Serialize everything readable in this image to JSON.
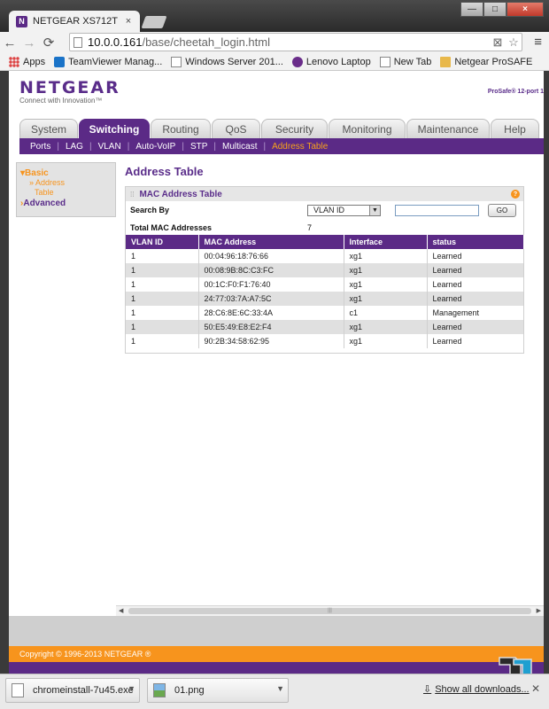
{
  "browser": {
    "tab_title": "NETGEAR XS712T",
    "tab_close": "×",
    "url_host": "10.0.0.161",
    "url_path": "/base/cheetah_login.html",
    "window_controls": [
      "—",
      "□",
      "×"
    ],
    "bookmarks": [
      {
        "label": "Apps",
        "icon": "apps-grid-icon"
      },
      {
        "label": "TeamViewer Manag...",
        "icon": "teamviewer-icon"
      },
      {
        "label": "Windows Server 201...",
        "icon": "page-icon"
      },
      {
        "label": "Lenovo Laptop",
        "icon": "peace-icon"
      },
      {
        "label": "New Tab",
        "icon": "page-icon"
      },
      {
        "label": "Netgear ProSAFE",
        "icon": "folder-icon"
      }
    ]
  },
  "header": {
    "logo": "NETGEAR",
    "tagline": "Connect with Innovation™",
    "product": "ProSafe® 12-port 1"
  },
  "nav": {
    "tabs": [
      "System",
      "Switching",
      "Routing",
      "QoS",
      "Security",
      "Monitoring",
      "Maintenance",
      "Help"
    ],
    "active_tab": "Switching",
    "subnav": [
      "Ports",
      "LAG",
      "VLAN",
      "Auto-VoIP",
      "STP",
      "Multicast",
      "Address Table"
    ],
    "active_subnav": "Address Table"
  },
  "sidebar": {
    "basic": "Basic",
    "basic_item": "» Address",
    "basic_item_2": "Table",
    "advanced": "Advanced"
  },
  "content": {
    "title": "Address Table",
    "panel_title": "MAC Address Table",
    "search_by_label": "Search By",
    "search_by_value": "VLAN ID",
    "search_input": "",
    "go_label": "GO",
    "total_label": "Total MAC Addresses",
    "total_value": "7",
    "columns": [
      "VLAN ID",
      "MAC Address",
      "Interface",
      "status"
    ],
    "rows": [
      [
        "1",
        "00:04:96:18:76:66",
        "xg1",
        "Learned"
      ],
      [
        "1",
        "00:08:9B:8C:C3:FC",
        "xg1",
        "Learned"
      ],
      [
        "1",
        "00:1C:F0:F1:76:40",
        "xg1",
        "Learned"
      ],
      [
        "1",
        "24:77:03:7A:A7:5C",
        "xg1",
        "Learned"
      ],
      [
        "1",
        "28:C6:8E:6C:33:4A",
        "c1",
        "Management"
      ],
      [
        "1",
        "50:E5:49:E8:E2:F4",
        "xg1",
        "Learned"
      ],
      [
        "1",
        "90:2B:34:58:62:95",
        "xg1",
        "Learned"
      ]
    ]
  },
  "footer": {
    "copyright": "Copyright © 1996-2013 NETGEAR ®"
  },
  "downloads": {
    "items": [
      "chromeinstall-7u45.exe",
      "01.png"
    ],
    "show_all": "Show all downloads..."
  },
  "colors": {
    "brand_purple": "#5b2a86",
    "brand_orange": "#f7941d"
  }
}
